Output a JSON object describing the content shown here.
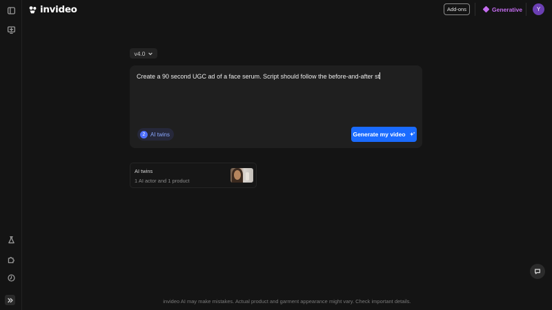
{
  "brand": {
    "name": "invideo"
  },
  "header": {
    "addons_label": "Add-ons",
    "generative_label": "Generative",
    "avatar_initial": "Y"
  },
  "sidebar": {
    "top_icons": [
      "sidebar-toggle-icon",
      "new-project-icon"
    ],
    "bottom_icons": [
      "flask-icon",
      "puzzle-icon",
      "history-icon"
    ],
    "expand_icon": "double-chevron-right-icon"
  },
  "composer": {
    "version_label": "v4.0",
    "prompt_text": "Create a 90 second UGC ad of a face serum. Script should follow the before-and-after st",
    "twins_count": "2",
    "twins_label": "AI twins",
    "generate_label": "Generate my video"
  },
  "twins_card": {
    "title": "AI twins",
    "subtitle": "1 AI actor and 1 product"
  },
  "footer": {
    "disclaimer": "invideo AI may make mistakes. Actual product and garment appearance might vary. Check important details."
  },
  "colors": {
    "background": "#141414",
    "accent_blue": "#1a6bff",
    "generative_purple": "#c46cf0",
    "avatar": "#6b3fb3"
  }
}
